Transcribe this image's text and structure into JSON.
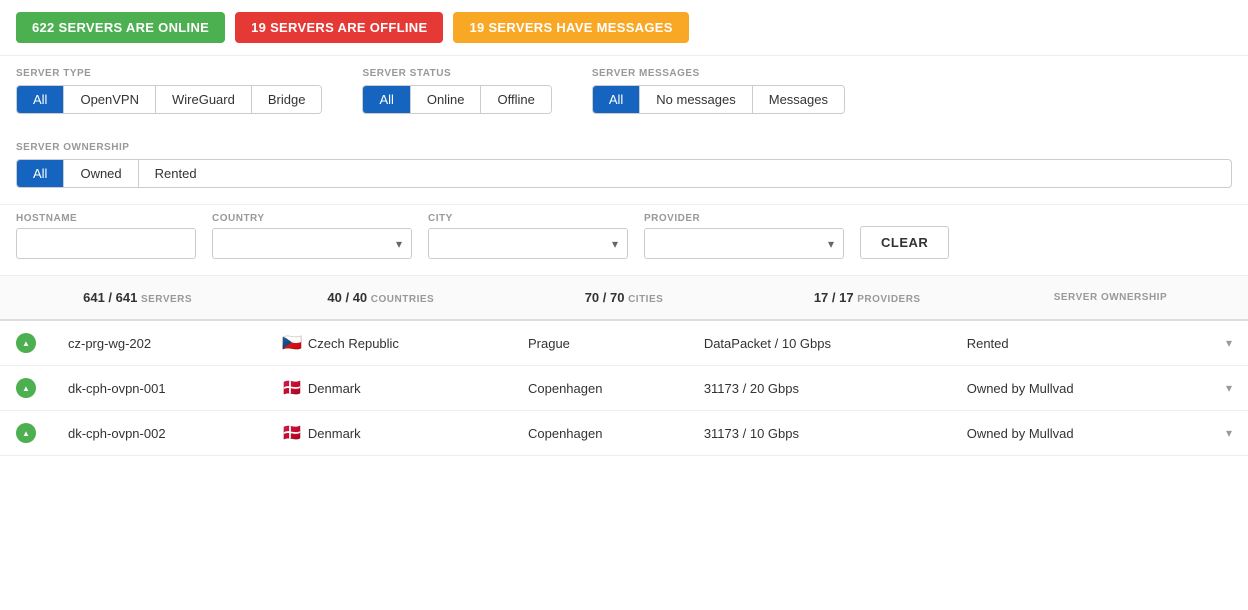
{
  "topbar": {
    "online_label": "622 SERVERS ARE ONLINE",
    "offline_label": "19 SERVERS ARE OFFLINE",
    "messages_label": "19 SERVERS HAVE MESSAGES"
  },
  "server_type": {
    "label": "SERVER TYPE",
    "buttons": [
      "All",
      "OpenVPN",
      "WireGuard",
      "Bridge"
    ],
    "active": "All"
  },
  "server_status": {
    "label": "SERVER STATUS",
    "buttons": [
      "All",
      "Online",
      "Offline"
    ],
    "active": "All"
  },
  "server_messages": {
    "label": "SERVER MESSAGES",
    "buttons": [
      "All",
      "No messages",
      "Messages"
    ],
    "active": "All"
  },
  "server_ownership_filter": {
    "label": "SERVER OWNERSHIP",
    "buttons": [
      "All",
      "Owned",
      "Rented"
    ],
    "active": "All"
  },
  "hostname_filter": {
    "label": "HOSTNAME",
    "placeholder": ""
  },
  "country_filter": {
    "label": "COUNTRY",
    "placeholder": ""
  },
  "city_filter": {
    "label": "CITY",
    "placeholder": ""
  },
  "provider_filter": {
    "label": "PROVIDER",
    "placeholder": ""
  },
  "clear_button": "CLEAR",
  "stats": {
    "servers": "641 / 641 SERVERS",
    "servers_num": "641",
    "servers_total": "641",
    "servers_label": "SERVERS",
    "countries": "40",
    "countries_total": "40",
    "countries_label": "COUNTRIES",
    "cities": "70",
    "cities_total": "70",
    "cities_label": "CITIES",
    "providers": "17",
    "providers_total": "17",
    "providers_label": "PROVIDERS",
    "ownership_label": "SERVER OWNERSHIP"
  },
  "rows": [
    {
      "hostname": "cz-prg-wg-202",
      "country": "Czech Republic",
      "flag": "🇨🇿",
      "city": "Prague",
      "provider": "DataPacket / 10 Gbps",
      "ownership": "Rented",
      "status": "online"
    },
    {
      "hostname": "dk-cph-ovpn-001",
      "country": "Denmark",
      "flag": "🇩🇰",
      "city": "Copenhagen",
      "provider": "31173 / 20 Gbps",
      "ownership": "Owned by Mullvad",
      "status": "online"
    },
    {
      "hostname": "dk-cph-ovpn-002",
      "country": "Denmark",
      "flag": "🇩🇰",
      "city": "Copenhagen",
      "provider": "31173 / 10 Gbps",
      "ownership": "Owned by Mullvad",
      "status": "online"
    }
  ]
}
